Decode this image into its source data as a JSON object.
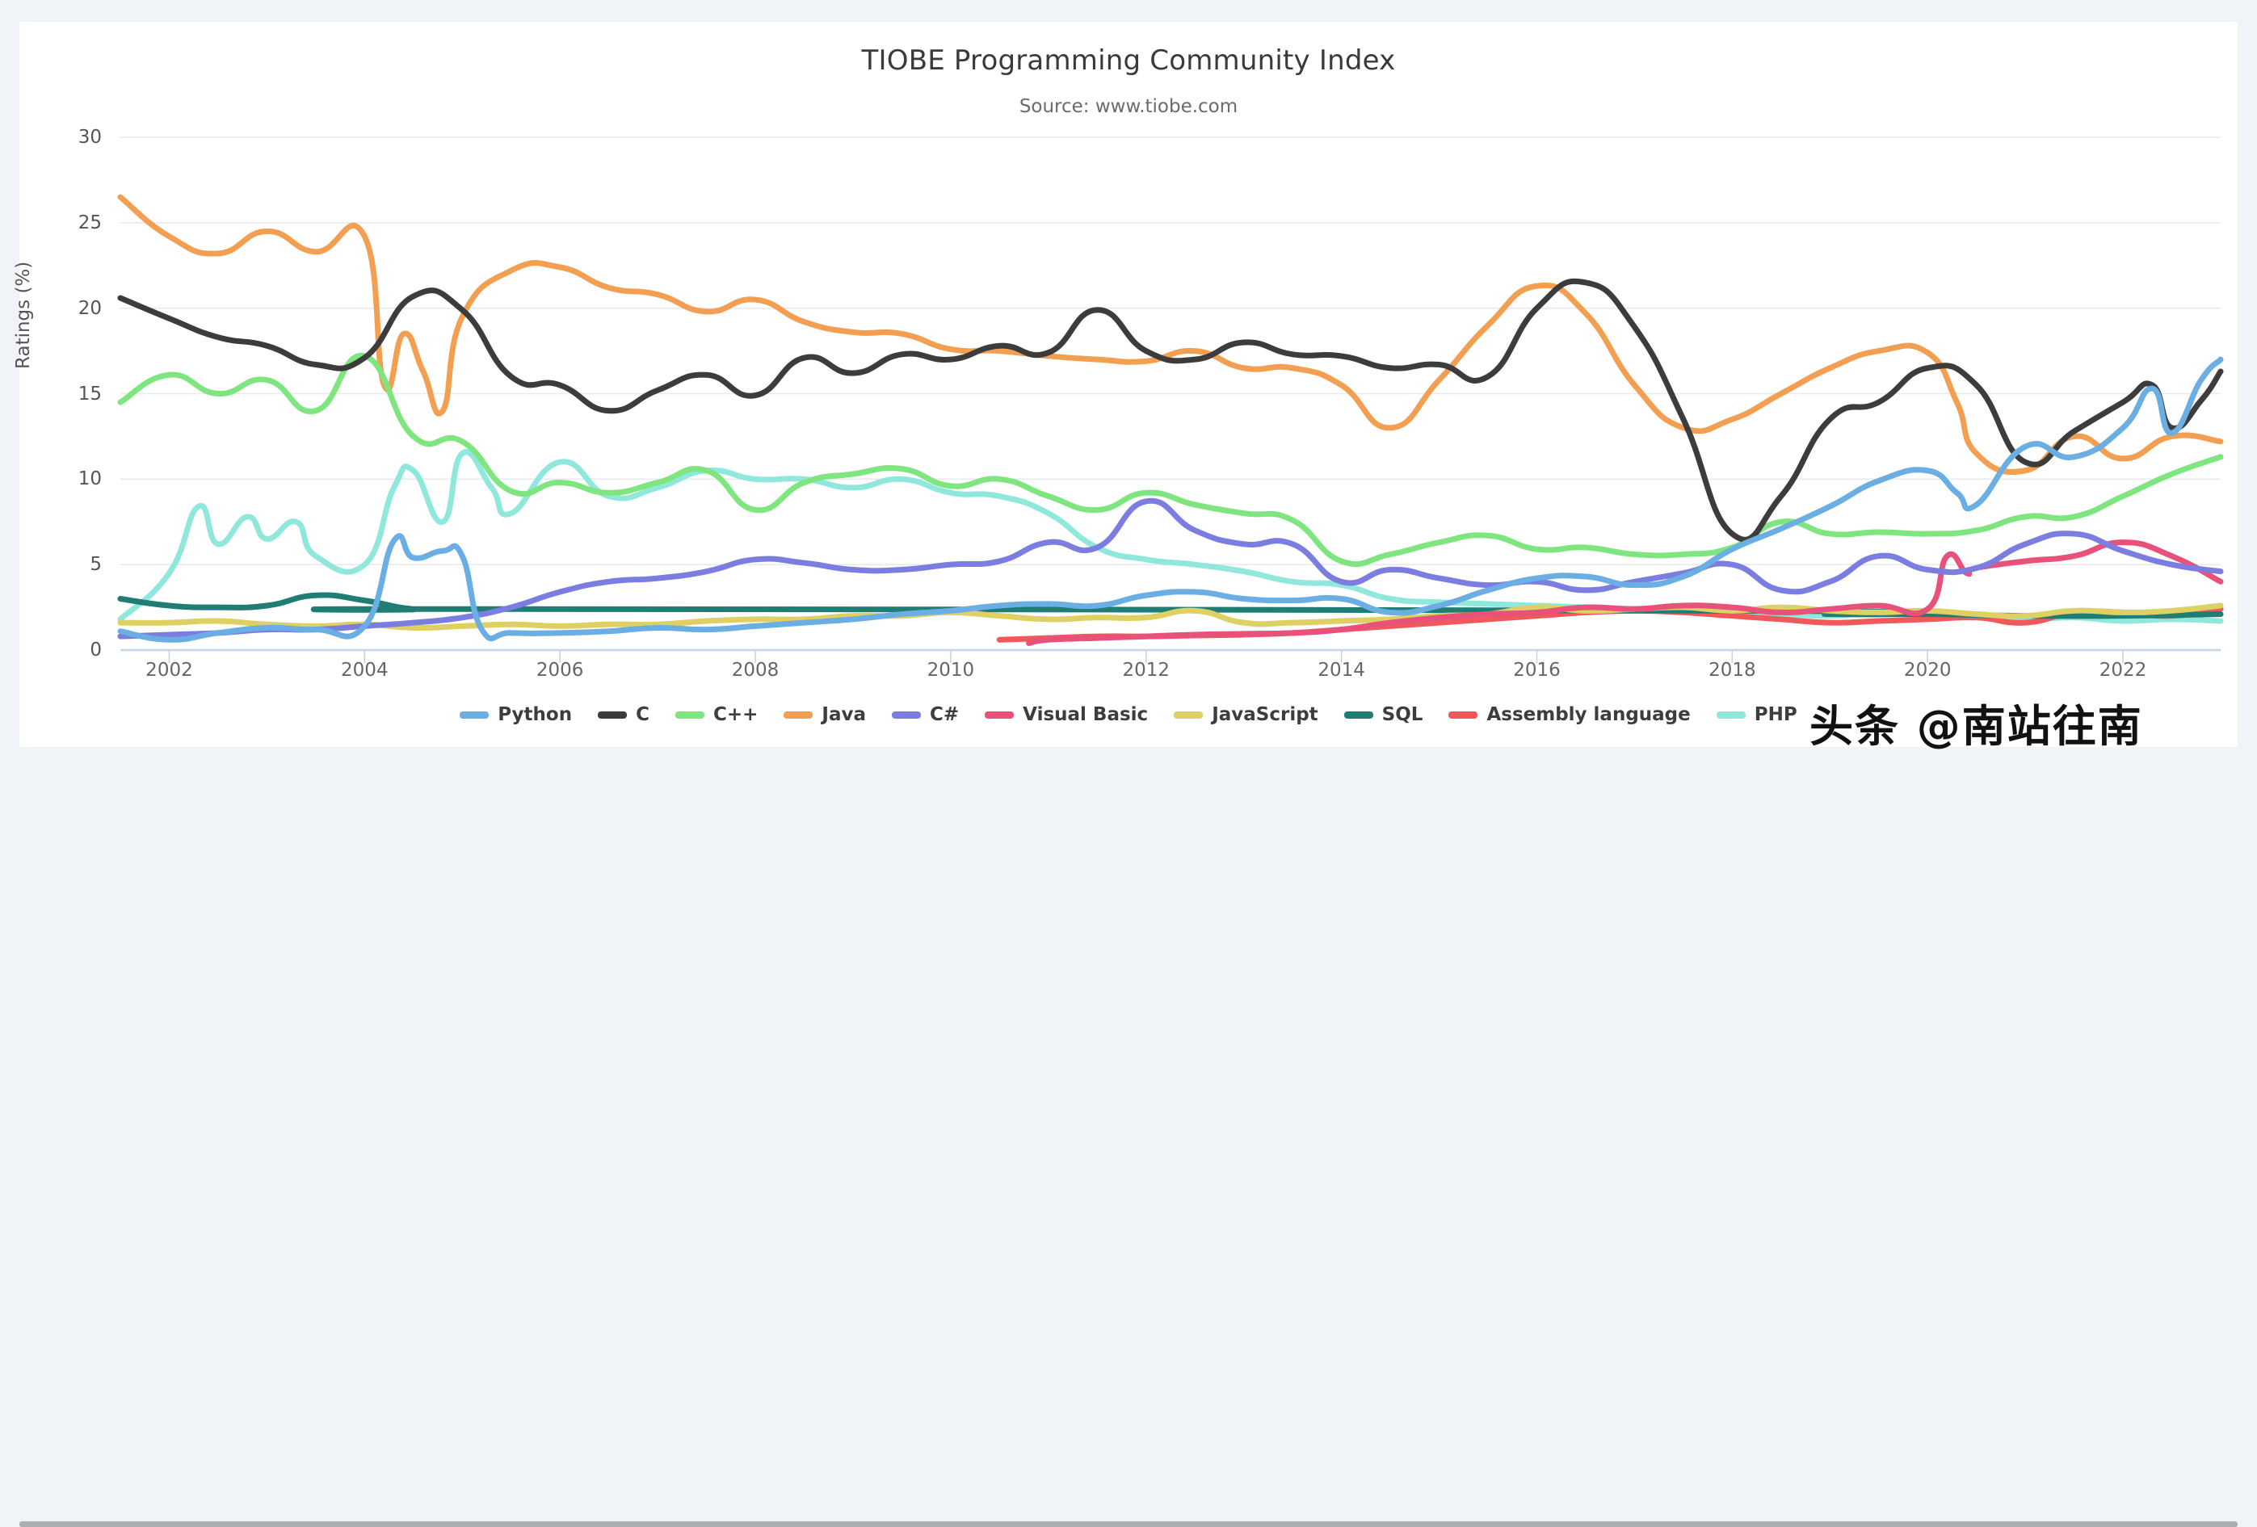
{
  "page": {
    "background_color": "#f0f4f8",
    "card_color": "#ffffff",
    "watermark": "头条 @南站往南"
  },
  "chart_data": {
    "type": "line",
    "title": "TIOBE Programming Community Index",
    "subtitle": "Source: www.tiobe.com",
    "xlabel": "",
    "ylabel": "Ratings (%)",
    "xlim": [
      2001.5,
      2023.0
    ],
    "ylim": [
      0,
      30
    ],
    "xticks": [
      "2002",
      "2004",
      "2006",
      "2008",
      "2010",
      "2012",
      "2014",
      "2016",
      "2018",
      "2020",
      "2022"
    ],
    "xtick_values": [
      2002,
      2004,
      2006,
      2008,
      2010,
      2012,
      2014,
      2016,
      2018,
      2020,
      2022
    ],
    "yticks": [
      "0",
      "5",
      "10",
      "15",
      "20",
      "25",
      "30"
    ],
    "ytick_values": [
      0,
      5,
      10,
      15,
      20,
      25,
      30
    ],
    "grid": "horizontal",
    "legend_position": "bottom",
    "series": [
      {
        "name": "Python",
        "color": "#6aaee4",
        "x": [
          2001.5,
          2002.0,
          2002.5,
          2003.0,
          2003.5,
          2004.0,
          2004.3,
          2004.5,
          2004.8,
          2005.0,
          2005.2,
          2005.5,
          2006.0,
          2006.5,
          2007.0,
          2007.5,
          2008.0,
          2008.5,
          2009.0,
          2009.5,
          2010.0,
          2010.5,
          2011.0,
          2011.5,
          2012.0,
          2012.5,
          2013.0,
          2013.5,
          2014.0,
          2014.5,
          2015.0,
          2015.5,
          2016.0,
          2016.5,
          2017.0,
          2017.5,
          2018.0,
          2018.5,
          2019.0,
          2019.5,
          2020.0,
          2020.3,
          2020.5,
          2021.0,
          2021.5,
          2022.0,
          2022.3,
          2022.5,
          2022.8,
          2023.0
        ],
        "y": [
          1.1,
          0.6,
          1.0,
          1.3,
          1.2,
          1.4,
          6.4,
          5.4,
          5.8,
          5.5,
          1.2,
          1.0,
          1.0,
          1.1,
          1.3,
          1.2,
          1.4,
          1.6,
          1.8,
          2.1,
          2.3,
          2.6,
          2.7,
          2.6,
          3.2,
          3.4,
          3.0,
          2.9,
          3.0,
          2.2,
          2.6,
          3.5,
          4.2,
          4.3,
          3.8,
          4.3,
          5.9,
          7.1,
          8.4,
          9.9,
          10.5,
          9.2,
          8.5,
          11.9,
          11.3,
          13.0,
          15.3,
          12.7,
          15.8,
          17.0
        ]
      },
      {
        "name": "C",
        "color": "#3c3c3c",
        "x": [
          2001.5,
          2002.0,
          2002.5,
          2003.0,
          2003.5,
          2004.0,
          2004.5,
          2005.0,
          2005.5,
          2006.0,
          2006.5,
          2007.0,
          2007.5,
          2008.0,
          2008.5,
          2009.0,
          2009.5,
          2010.0,
          2010.5,
          2011.0,
          2011.5,
          2012.0,
          2012.5,
          2013.0,
          2013.5,
          2014.0,
          2014.5,
          2015.0,
          2015.5,
          2016.0,
          2016.5,
          2017.0,
          2017.5,
          2018.0,
          2018.5,
          2019.0,
          2019.5,
          2020.0,
          2020.5,
          2021.0,
          2021.5,
          2022.0,
          2022.3,
          2022.5,
          2022.8,
          2023.0
        ],
        "y": [
          20.6,
          19.4,
          18.3,
          17.8,
          16.7,
          17.1,
          20.7,
          19.9,
          16.0,
          15.5,
          14.0,
          15.2,
          16.1,
          14.9,
          17.1,
          16.2,
          17.3,
          17.0,
          17.8,
          17.4,
          19.9,
          17.5,
          17.0,
          18.0,
          17.3,
          17.2,
          16.5,
          16.7,
          16.0,
          20.0,
          21.5,
          18.9,
          13.5,
          6.8,
          9.0,
          13.5,
          14.5,
          16.5,
          15.5,
          11.0,
          12.8,
          14.5,
          15.5,
          13.0,
          14.6,
          16.3
        ]
      },
      {
        "name": "C++",
        "color": "#7fe67f",
        "x": [
          2001.5,
          2002.0,
          2002.5,
          2003.0,
          2003.5,
          2004.0,
          2004.5,
          2005.0,
          2005.5,
          2006.0,
          2006.5,
          2007.0,
          2007.5,
          2008.0,
          2008.5,
          2009.0,
          2009.5,
          2010.0,
          2010.5,
          2011.0,
          2011.5,
          2012.0,
          2012.5,
          2013.0,
          2013.5,
          2014.0,
          2014.5,
          2015.0,
          2015.5,
          2016.0,
          2016.5,
          2017.0,
          2017.5,
          2018.0,
          2018.5,
          2019.0,
          2019.5,
          2020.0,
          2020.5,
          2021.0,
          2021.5,
          2022.0,
          2022.5,
          2023.0
        ],
        "y": [
          14.5,
          16.1,
          15.0,
          15.8,
          14.0,
          17.2,
          12.5,
          12.2,
          9.3,
          9.8,
          9.2,
          9.8,
          10.5,
          8.2,
          9.8,
          10.3,
          10.6,
          9.6,
          10.0,
          9.0,
          8.2,
          9.2,
          8.5,
          8.0,
          7.6,
          5.2,
          5.6,
          6.3,
          6.7,
          5.9,
          6.0,
          5.6,
          5.6,
          6.0,
          7.5,
          6.8,
          6.9,
          6.8,
          7.0,
          7.8,
          7.8,
          9.0,
          10.3,
          11.3
        ]
      },
      {
        "name": "Java",
        "color": "#f29f52",
        "x": [
          2001.5,
          2002.0,
          2002.5,
          2003.0,
          2003.5,
          2004.0,
          2004.2,
          2004.4,
          2004.6,
          2004.8,
          2005.0,
          2005.5,
          2006.0,
          2006.5,
          2007.0,
          2007.5,
          2008.0,
          2008.5,
          2009.0,
          2009.5,
          2010.0,
          2010.5,
          2011.0,
          2011.5,
          2012.0,
          2012.5,
          2013.0,
          2013.5,
          2014.0,
          2014.5,
          2015.0,
          2015.5,
          2016.0,
          2016.5,
          2017.0,
          2017.5,
          2018.0,
          2018.5,
          2019.0,
          2019.5,
          2020.0,
          2020.3,
          2020.5,
          2021.0,
          2021.5,
          2022.0,
          2022.5,
          2023.0
        ],
        "y": [
          26.5,
          24.2,
          23.2,
          24.5,
          23.3,
          24.2,
          15.5,
          18.5,
          16.3,
          14.0,
          19.5,
          22.2,
          22.4,
          21.2,
          20.8,
          19.8,
          20.5,
          19.2,
          18.6,
          18.5,
          17.6,
          17.5,
          17.2,
          17.0,
          16.9,
          17.5,
          16.5,
          16.5,
          15.5,
          13.0,
          15.8,
          19.0,
          21.3,
          19.7,
          15.5,
          13.0,
          13.5,
          15.0,
          16.5,
          17.5,
          17.4,
          14.5,
          11.5,
          10.5,
          12.5,
          11.2,
          12.5,
          12.2
        ]
      },
      {
        "name": "C#",
        "color": "#7b7ee0",
        "x": [
          2001.5,
          2002.0,
          2002.5,
          2003.0,
          2003.5,
          2004.0,
          2004.5,
          2005.0,
          2005.5,
          2006.0,
          2006.5,
          2007.0,
          2007.5,
          2008.0,
          2008.5,
          2009.0,
          2009.5,
          2010.0,
          2010.5,
          2011.0,
          2011.5,
          2012.0,
          2012.5,
          2013.0,
          2013.5,
          2014.0,
          2014.5,
          2015.0,
          2015.5,
          2016.0,
          2016.5,
          2017.0,
          2017.5,
          2018.0,
          2018.5,
          2019.0,
          2019.5,
          2020.0,
          2020.5,
          2021.0,
          2021.5,
          2022.0,
          2022.5,
          2023.0
        ],
        "y": [
          0.8,
          0.9,
          1.0,
          1.2,
          1.2,
          1.4,
          1.6,
          1.9,
          2.5,
          3.4,
          4.0,
          4.2,
          4.6,
          5.3,
          5.1,
          4.7,
          4.7,
          5.0,
          5.2,
          6.3,
          6.0,
          8.7,
          7.0,
          6.2,
          6.2,
          4.0,
          4.7,
          4.2,
          3.8,
          4.0,
          3.5,
          4.0,
          4.5,
          5.0,
          3.5,
          4.0,
          5.5,
          4.7,
          4.8,
          6.2,
          6.8,
          5.8,
          5.0,
          4.6
        ]
      },
      {
        "name": "Visual Basic",
        "color": "#e8527a",
        "x": [
          2010.8,
          2011.0,
          2011.5,
          2012.0,
          2012.5,
          2013.0,
          2013.5,
          2014.0,
          2014.5,
          2015.0,
          2015.5,
          2016.0,
          2016.5,
          2017.0,
          2017.5,
          2018.0,
          2018.5,
          2019.0,
          2019.5,
          2020.0,
          2020.2,
          2020.4,
          2020.5,
          2021.0,
          2021.5,
          2022.0,
          2022.5,
          2023.0
        ],
        "y": [
          0.4,
          0.6,
          0.7,
          0.8,
          0.9,
          0.95,
          1.0,
          1.2,
          1.6,
          1.9,
          2.1,
          2.2,
          2.5,
          2.4,
          2.6,
          2.5,
          2.2,
          2.4,
          2.6,
          2.4,
          5.5,
          4.5,
          4.8,
          5.2,
          5.5,
          6.3,
          5.5,
          4.0
        ]
      },
      {
        "name": "JavaScript",
        "color": "#ded063",
        "x": [
          2001.5,
          2002.0,
          2002.5,
          2003.0,
          2003.5,
          2004.0,
          2004.5,
          2005.0,
          2005.5,
          2006.0,
          2006.5,
          2007.0,
          2007.5,
          2008.0,
          2008.5,
          2009.0,
          2009.5,
          2010.0,
          2010.5,
          2011.0,
          2011.5,
          2012.0,
          2012.5,
          2013.0,
          2013.5,
          2014.0,
          2014.5,
          2015.0,
          2015.5,
          2016.0,
          2016.5,
          2017.0,
          2017.5,
          2018.0,
          2018.5,
          2019.0,
          2019.5,
          2020.0,
          2020.5,
          2021.0,
          2021.5,
          2022.0,
          2022.5,
          2023.0
        ],
        "y": [
          1.6,
          1.6,
          1.7,
          1.5,
          1.4,
          1.5,
          1.3,
          1.4,
          1.5,
          1.4,
          1.5,
          1.5,
          1.7,
          1.8,
          1.8,
          2.0,
          2.0,
          2.2,
          2.0,
          1.8,
          1.9,
          1.9,
          2.3,
          1.6,
          1.6,
          1.7,
          1.8,
          2.0,
          2.1,
          2.5,
          2.3,
          2.4,
          2.5,
          2.3,
          2.5,
          2.3,
          2.2,
          2.3,
          2.1,
          2.0,
          2.3,
          2.2,
          2.3,
          2.6
        ]
      },
      {
        "name": "SQL",
        "color": "#1f7d73",
        "x": [
          2001.5,
          2002.0,
          2002.5,
          2003.0,
          2003.5,
          2004.0,
          2004.5,
          2005.0,
          2018.0,
          2019.0,
          2020.0,
          2021.0,
          2022.0,
          2023.0
        ],
        "y": [
          3.0,
          2.6,
          2.5,
          2.6,
          3.2,
          2.9,
          2.4,
          2.4,
          2.3,
          2.1,
          2.1,
          2.0,
          2.0,
          2.1
        ]
      },
      {
        "name": "Assembly language",
        "color": "#f0595c",
        "x": [
          2010.5,
          2011.0,
          2011.5,
          2012.0,
          2012.5,
          2013.0,
          2013.5,
          2014.0,
          2014.5,
          2015.0,
          2015.5,
          2016.0,
          2016.5,
          2017.0,
          2017.5,
          2018.0,
          2018.5,
          2019.0,
          2019.5,
          2020.0,
          2020.5,
          2021.0,
          2021.5,
          2022.0,
          2022.5,
          2023.0
        ],
        "y": [
          0.6,
          0.7,
          0.8,
          0.8,
          0.85,
          0.9,
          1.0,
          1.2,
          1.4,
          1.6,
          1.8,
          2.0,
          2.2,
          2.3,
          2.2,
          2.0,
          1.8,
          1.6,
          1.7,
          1.8,
          1.9,
          1.6,
          2.2,
          2.2,
          2.0,
          2.4
        ]
      },
      {
        "name": "PHP",
        "color": "#90e8dc",
        "x": [
          2001.5,
          2002.0,
          2002.3,
          2002.5,
          2002.8,
          2003.0,
          2003.3,
          2003.5,
          2004.0,
          2004.3,
          2004.5,
          2004.8,
          2005.0,
          2005.3,
          2005.5,
          2006.0,
          2006.5,
          2007.0,
          2007.5,
          2008.0,
          2008.5,
          2009.0,
          2009.5,
          2010.0,
          2010.5,
          2011.0,
          2011.5,
          2012.0,
          2012.5,
          2013.0,
          2013.5,
          2014.0,
          2014.5,
          2015.0,
          2015.5,
          2016.0,
          2016.5,
          2017.0,
          2017.5,
          2018.0,
          2018.5,
          2019.0,
          2019.5,
          2020.0,
          2020.5,
          2021.0,
          2021.5,
          2022.0,
          2022.5,
          2023.0
        ],
        "y": [
          1.8,
          4.5,
          8.4,
          6.2,
          7.8,
          6.5,
          7.5,
          5.5,
          5.0,
          9.5,
          10.5,
          7.5,
          11.5,
          9.5,
          8.0,
          11.0,
          9.0,
          9.5,
          10.5,
          10.0,
          10.0,
          9.5,
          10.0,
          9.2,
          9.0,
          8.0,
          6.0,
          5.3,
          5.0,
          4.6,
          4.0,
          3.8,
          3.0,
          2.8,
          2.7,
          2.6,
          2.5,
          2.4,
          2.3,
          2.2,
          2.1,
          2.0,
          2.2,
          2.0,
          2.1,
          1.8,
          1.9,
          1.7,
          1.8,
          1.7
        ]
      }
    ]
  }
}
